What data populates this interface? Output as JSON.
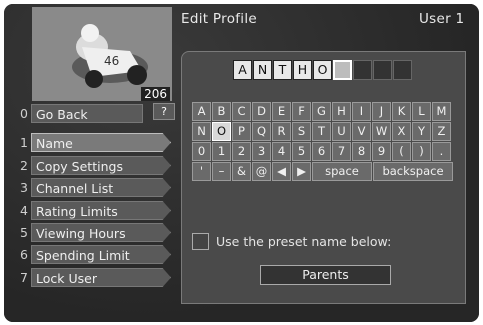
{
  "header": {
    "title": "Edit Profile",
    "user": "User 1"
  },
  "thumbnail": {
    "channel_number": "206"
  },
  "go_back": {
    "number": "0",
    "label": "Go Back",
    "help": "?"
  },
  "menu": [
    {
      "number": "1",
      "label": "Name"
    },
    {
      "number": "2",
      "label": "Copy Settings"
    },
    {
      "number": "3",
      "label": "Channel List"
    },
    {
      "number": "4",
      "label": "Rating Limits"
    },
    {
      "number": "5",
      "label": "Viewing Hours"
    },
    {
      "number": "6",
      "label": "Spending Limit"
    },
    {
      "number": "7",
      "label": "Lock User"
    }
  ],
  "entry": {
    "chars": [
      "A",
      "N",
      "T",
      "H",
      "O",
      "",
      "",
      "",
      ""
    ]
  },
  "keyboard": {
    "rows": [
      [
        "A",
        "B",
        "C",
        "D",
        "E",
        "F",
        "G",
        "H",
        "I",
        "J",
        "K",
        "L",
        "M"
      ],
      [
        "N",
        "O",
        "P",
        "Q",
        "R",
        "S",
        "T",
        "U",
        "V",
        "W",
        "X",
        "Y",
        "Z"
      ],
      [
        "0",
        "1",
        "2",
        "3",
        "4",
        "5",
        "6",
        "7",
        "8",
        "9",
        "(",
        ")",
        "."
      ],
      [
        "'",
        "–",
        "&",
        "@",
        "◀",
        "▶"
      ]
    ],
    "space": "space",
    "backspace": "backspace"
  },
  "preset": {
    "checkbox_label": "Use the preset name below:",
    "value": "Parents"
  }
}
